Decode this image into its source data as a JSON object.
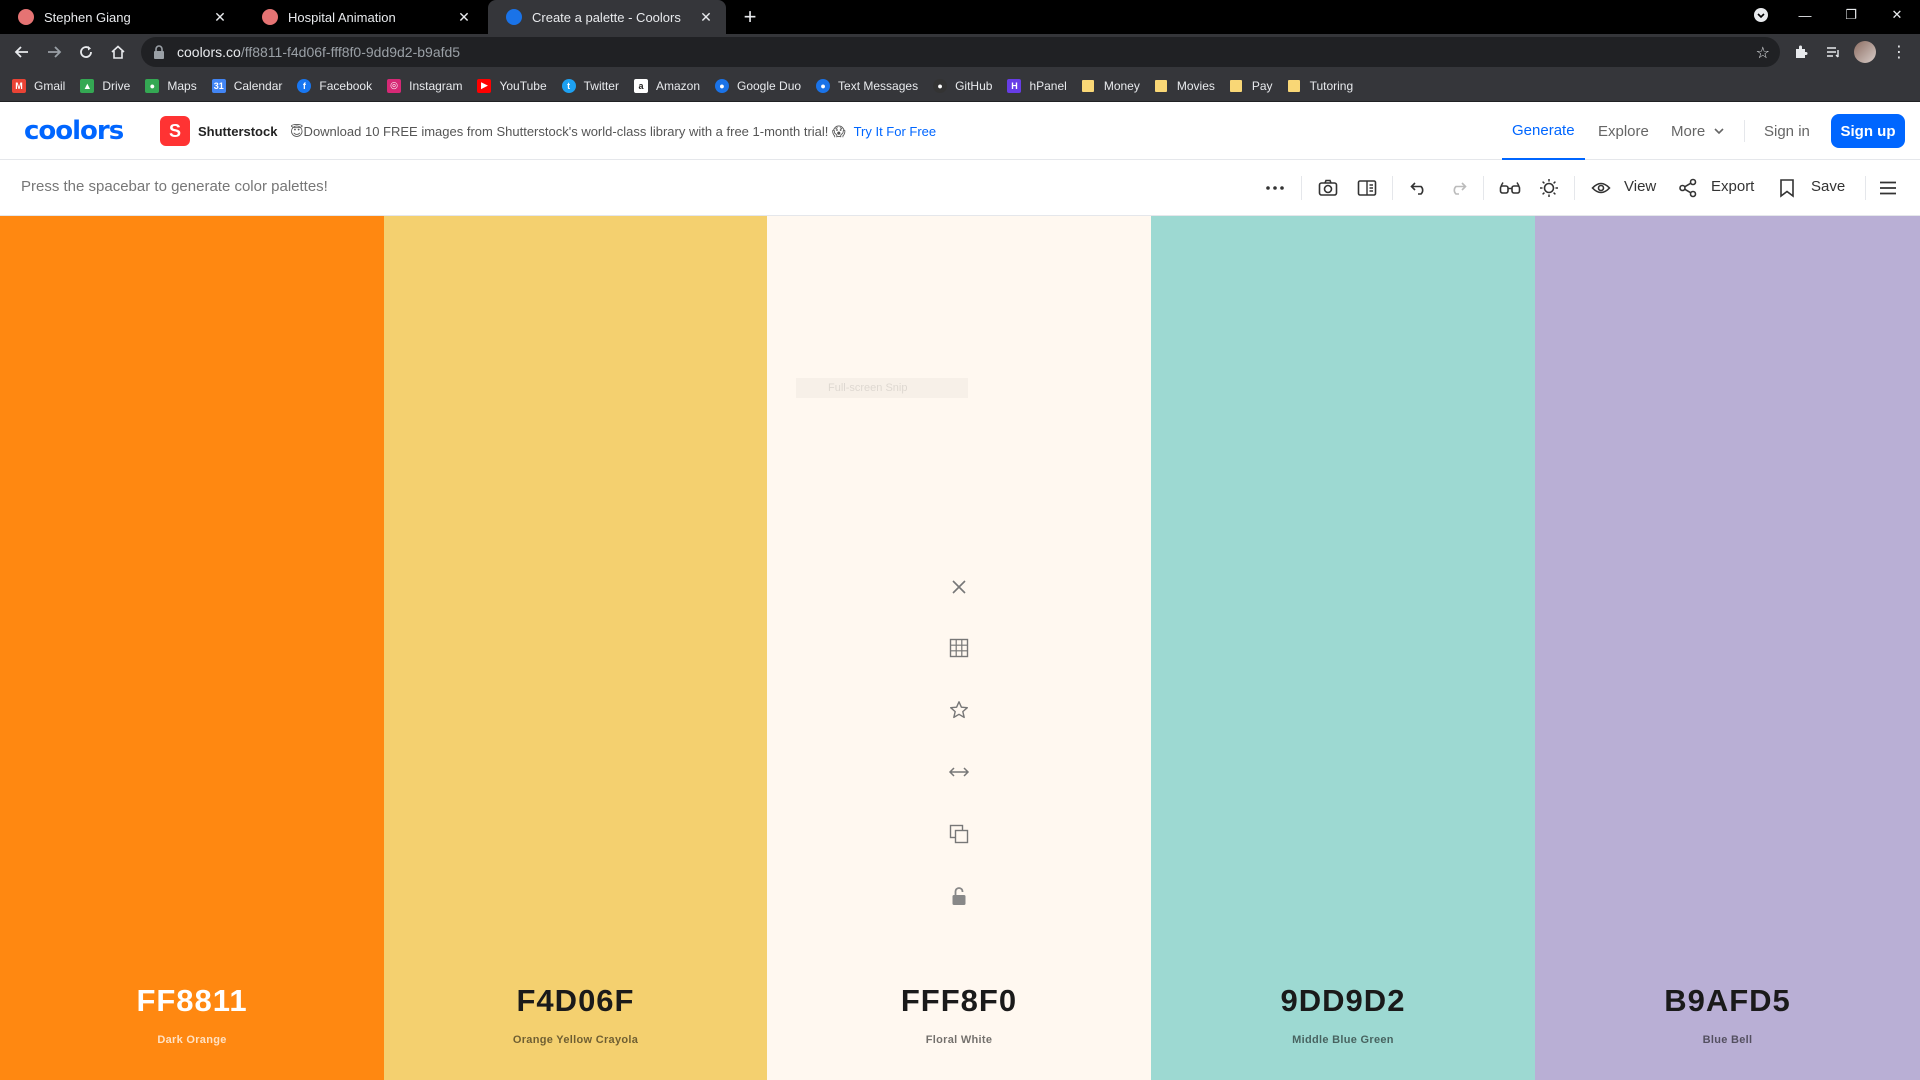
{
  "browser": {
    "tabs": [
      {
        "title": "Stephen Giang",
        "favicon_color": "#e57373"
      },
      {
        "title": "Hospital Animation",
        "favicon_color": "#e57373"
      },
      {
        "title": "Create a palette - Coolors",
        "favicon_color": "#1a73e8"
      }
    ],
    "url_host": "coolors.co",
    "url_path": "/ff8811-f4d06f-fff8f0-9dd9d2-b9afd5",
    "bookmarks": [
      {
        "label": "Gmail",
        "color": "#ea4335",
        "glyph": "M"
      },
      {
        "label": "Drive",
        "color": "#34a853",
        "glyph": "▲"
      },
      {
        "label": "Maps",
        "color": "#34a853",
        "glyph": "●"
      },
      {
        "label": "Calendar",
        "color": "#4285f4",
        "glyph": "31"
      },
      {
        "label": "Facebook",
        "color": "#1877f2",
        "glyph": "f"
      },
      {
        "label": "Instagram",
        "color": "#d62976",
        "glyph": "◎"
      },
      {
        "label": "YouTube",
        "color": "#ff0000",
        "glyph": "▶"
      },
      {
        "label": "Twitter",
        "color": "#1da1f2",
        "glyph": "t"
      },
      {
        "label": "Amazon",
        "color": "#222222",
        "glyph": "a"
      },
      {
        "label": "Google Duo",
        "color": "#1a73e8",
        "glyph": "●"
      },
      {
        "label": "Text Messages",
        "color": "#1a73e8",
        "glyph": "●"
      },
      {
        "label": "GitHub",
        "color": "#333333",
        "glyph": "●"
      },
      {
        "label": "hPanel",
        "color": "#673de6",
        "glyph": "H"
      }
    ],
    "bookmark_folders": [
      "Money",
      "Movies",
      "Pay",
      "Tutoring"
    ]
  },
  "header": {
    "logo": "coolors",
    "sponsor_name": "Shutterstock",
    "promo_text": "😇Download 10 FREE images from Shutterstock's world-class library with a free 1-month trial! 😱",
    "promo_cta": "Try It For Free",
    "nav_generate": "Generate",
    "nav_explore": "Explore",
    "nav_more": "More",
    "sign_in": "Sign in",
    "sign_up": "Sign up"
  },
  "subbar": {
    "hint": "Press the spacebar to generate color palettes!",
    "view_label": "View",
    "export_label": "Export",
    "save_label": "Save"
  },
  "palette": {
    "snip_overlay": "Full-screen Snip",
    "colors": [
      {
        "hex": "FF8811",
        "name": "Dark Orange",
        "color": "#ff8811",
        "text_tone": "dark"
      },
      {
        "hex": "F4D06F",
        "name": "Orange Yellow Crayola",
        "color": "#f4d06f",
        "text_tone": "light"
      },
      {
        "hex": "FFF8F0",
        "name": "Floral White",
        "color": "#fff8f0",
        "text_tone": "light"
      },
      {
        "hex": "9DD9D2",
        "name": "Middle Blue Green",
        "color": "#9dd9d2",
        "text_tone": "light"
      },
      {
        "hex": "B9AFD5",
        "name": "Blue Bell",
        "color": "#b9afd5",
        "text_tone": "light"
      }
    ],
    "hover_tools": [
      "close-icon",
      "shades-grid-icon",
      "favorite-star-icon",
      "drag-arrows-icon",
      "copy-icon",
      "lock-icon"
    ]
  }
}
